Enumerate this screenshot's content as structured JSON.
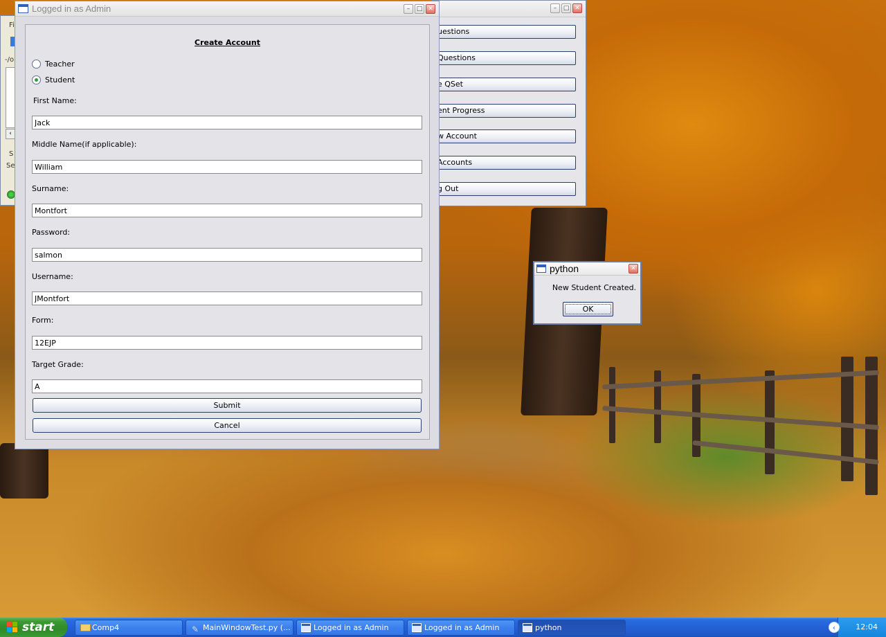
{
  "desktop": {
    "wallpaper": "autumn-path"
  },
  "left_window": {
    "fragments": [
      "Fi",
      "-/o",
      "S",
      "Se"
    ]
  },
  "admin_window": {
    "buttons": [
      "uestions",
      "Questions",
      "e QSet",
      "ent Progress",
      "w Account",
      "Accounts",
      "g Out"
    ]
  },
  "create_window": {
    "title": "Logged in as Admin",
    "heading": "Create Account",
    "account_type": {
      "options": [
        "Teacher",
        "Student"
      ],
      "selected": "Student"
    },
    "fields": [
      {
        "label": "First Name:",
        "value": "Jack"
      },
      {
        "label": "Middle Name(if applicable):",
        "value": "William"
      },
      {
        "label": "Surname:",
        "value": "Montfort"
      },
      {
        "label": "Password:",
        "value": "salmon"
      },
      {
        "label": "Username:",
        "value": "JMontfort"
      },
      {
        "label": "Form:",
        "value": "12EJP"
      },
      {
        "label": "Target Grade:",
        "value": "A"
      }
    ],
    "submit_label": "Submit",
    "cancel_label": "Cancel"
  },
  "message_box": {
    "title": "python",
    "message": "New Student Created.",
    "ok_label": "OK"
  },
  "taskbar": {
    "start_label": "start",
    "items": [
      {
        "label": "Comp4",
        "icon": "folder-icon",
        "active": false
      },
      {
        "label": "MainWindowTest.py (...",
        "icon": "python-file-icon",
        "active": false
      },
      {
        "label": "Logged in as Admin",
        "icon": "window-icon",
        "active": false
      },
      {
        "label": "Logged in as Admin",
        "icon": "window-icon",
        "active": false
      },
      {
        "label": "python",
        "icon": "window-icon",
        "active": true
      }
    ],
    "clock": "12:04"
  },
  "colors": {
    "taskbar_blue": "#2460d6",
    "start_green": "#3d9a33",
    "radio_check": "#2c9c3a",
    "close_red": "#e07060"
  }
}
